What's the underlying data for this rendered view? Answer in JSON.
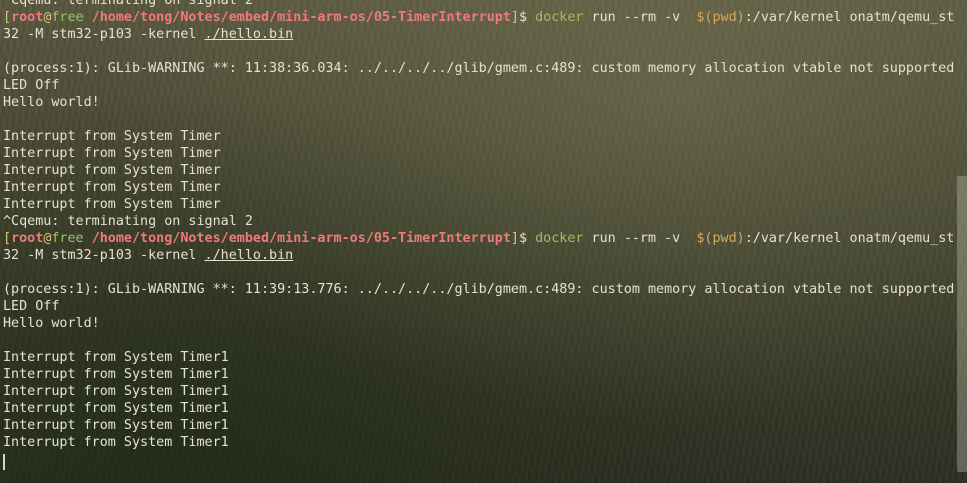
{
  "terminal": {
    "partial_top": "^Cqemu: terminating on signal 2",
    "runs": [
      {
        "prompt": {
          "open": "[",
          "user": "root",
          "at": "@",
          "host": "free",
          "path": "/home/tong/Notes/embed/mini-arm-os/05-TimerInterrupt",
          "close": "]",
          "dollar": "$"
        },
        "command_tool": "docker",
        "command_args_1": " run --rm -v ",
        "command_subshell": " $(pwd)",
        "command_args_2": ":/var/kernel onatm/qemu_stm",
        "command_wrap": "32 -M stm32-p103 -kernel ",
        "command_file": "./hello.bin",
        "warning": "(process:1): GLib-WARNING **: 11:38:36.034: ../../../../glib/gmem.c:489: custom memory allocation vtable not supported",
        "led": "LED Off",
        "hello": "Hello world!",
        "interrupts": [
          "Interrupt from System Timer",
          "Interrupt from System Timer",
          "Interrupt from System Timer",
          "Interrupt from System Timer",
          "Interrupt from System Timer"
        ],
        "terminate": "^Cqemu: terminating on signal 2"
      },
      {
        "prompt": {
          "open": "[",
          "user": "root",
          "at": "@",
          "host": "free",
          "path": "/home/tong/Notes/embed/mini-arm-os/05-TimerInterrupt",
          "close": "]",
          "dollar": "$"
        },
        "command_tool": "docker",
        "command_args_1": " run --rm -v ",
        "command_subshell": " $(pwd)",
        "command_args_2": ":/var/kernel onatm/qemu_stm",
        "command_wrap": "32 -M stm32-p103 -kernel ",
        "command_file": "./hello.bin",
        "warning": "(process:1): GLib-WARNING **: 11:39:13.776: ../../../../glib/gmem.c:489: custom memory allocation vtable not supported",
        "led": "LED Off",
        "hello": "Hello world!",
        "interrupts": [
          "Interrupt from System Timer1",
          "Interrupt from System Timer1",
          "Interrupt from System Timer1",
          "Interrupt from System Timer1",
          "Interrupt from System Timer1",
          "Interrupt from System Timer1"
        ]
      }
    ]
  }
}
